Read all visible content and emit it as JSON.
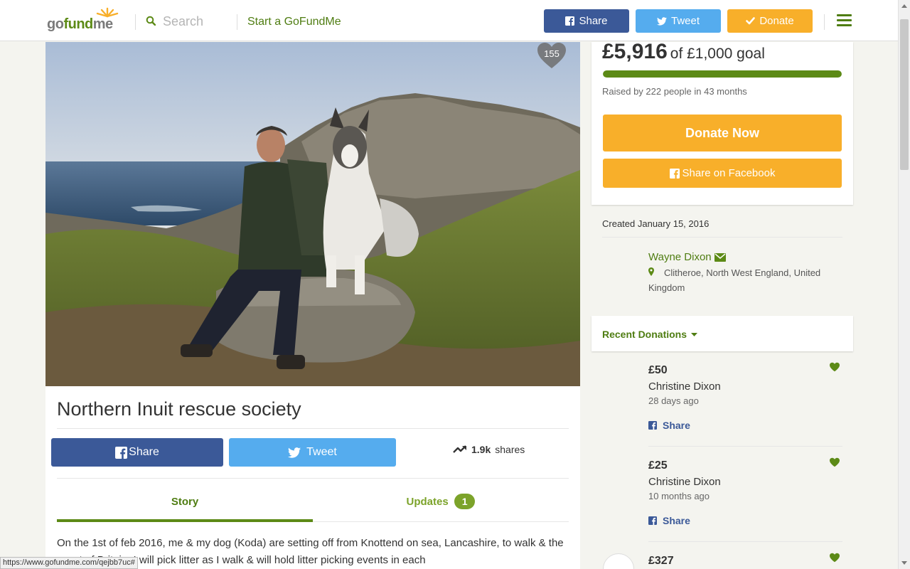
{
  "header": {
    "logo": {
      "go": "go",
      "fund": "fund",
      "me": "me"
    },
    "search_placeholder": "Search",
    "start_link": "Start a GoFundMe",
    "share_label": "Share",
    "tweet_label": "Tweet",
    "donate_label": "Donate"
  },
  "campaign": {
    "title": "Northern Inuit rescue society",
    "hearts": "155",
    "share_label": "Share",
    "tweet_label": "Tweet",
    "shares_count": "1.9k",
    "shares_label": "shares",
    "tabs": [
      {
        "label": "Story"
      },
      {
        "label": "Updates",
        "count": "1"
      }
    ],
    "story": "On the 1st of feb 2016, me & my dog (Koda) are setting off from Knottend on sea, Lancashire, to walk & the coast of Britain. I will pick litter as I walk & will hold litter picking events in each"
  },
  "status_url": "https://www.gofundme.com/qejbb7uc#",
  "funding": {
    "raised": "£5,916",
    "goal_text": "of £1,000 goal",
    "progress_fraction": 1.0,
    "raised_by": "Raised by 222 people in 43 months",
    "donate_now": "Donate Now",
    "share_facebook": "Share on Facebook"
  },
  "organizer": {
    "created": "Created January 15, 2016",
    "name": "Wayne Dixon",
    "location": "Clitheroe, North West England, United Kingdom"
  },
  "recent": {
    "title": "Recent Donations",
    "donations": [
      {
        "amount": "£50",
        "name": "Christine Dixon",
        "when": "28 days ago",
        "share": "Share"
      },
      {
        "amount": "£25",
        "name": "Christine Dixon",
        "when": "10 months ago",
        "share": "Share"
      },
      {
        "amount": "£327"
      }
    ]
  },
  "colors": {
    "brand_green": "#5c8a16",
    "facebook": "#3b5998",
    "twitter": "#55acee",
    "donate_orange": "#f8af2a"
  }
}
